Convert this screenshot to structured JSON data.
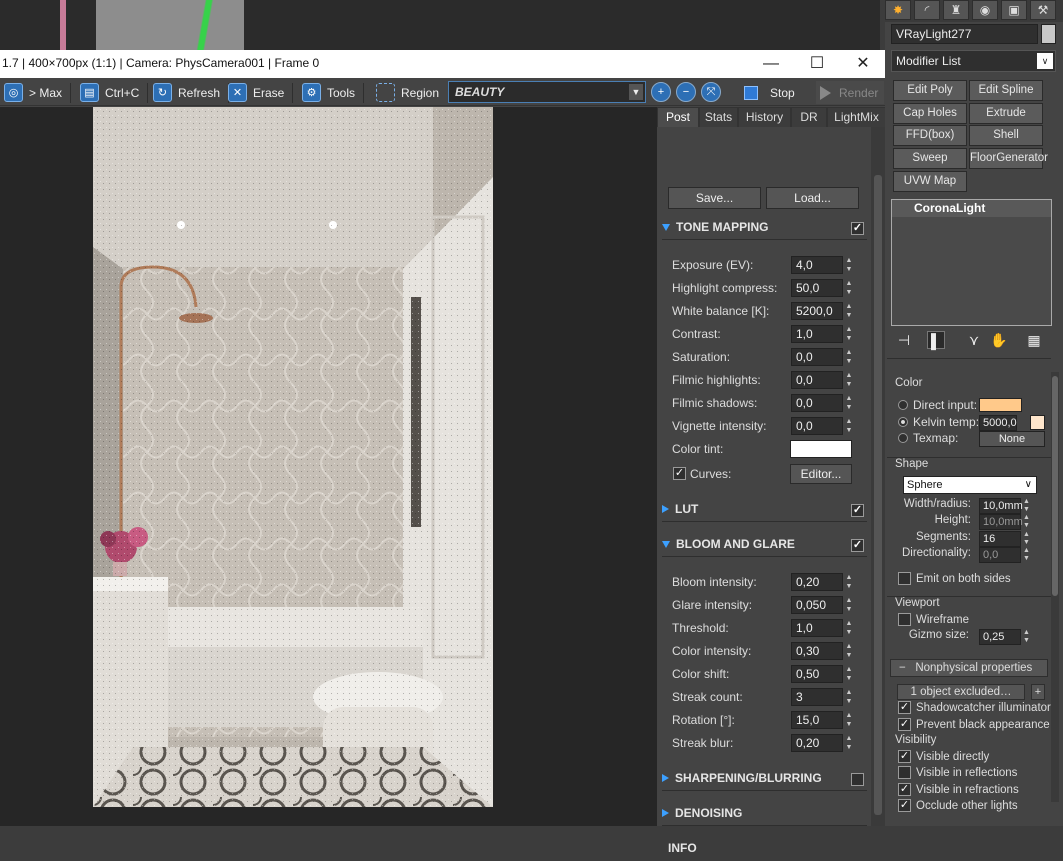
{
  "window": {
    "title": "1.7 | 400×700px (1:1) | Camera: PhysCamera001 | Frame 0",
    "minimize": "—",
    "maximize": "☐",
    "close": "✕"
  },
  "toolbar": {
    "to_max": "> Max",
    "copy": "Ctrl+C",
    "refresh": "Refresh",
    "erase": "Erase",
    "tools": "Tools",
    "region": "Region",
    "channel": "BEAUTY",
    "stop": "Stop",
    "render": "Render"
  },
  "tabs": [
    "Post",
    "Stats",
    "History",
    "DR",
    "LightMix"
  ],
  "post": {
    "save": "Save...",
    "load": "Load...",
    "tone_mapping": {
      "title": "TONE MAPPING",
      "checked": true,
      "rows": [
        {
          "label": "Exposure (EV):",
          "value": "4,0"
        },
        {
          "label": "Highlight compress:",
          "value": "50,0"
        },
        {
          "label": "White balance [K]:",
          "value": "5200,0"
        },
        {
          "label": "Contrast:",
          "value": "1,0"
        },
        {
          "label": "Saturation:",
          "value": "0,0"
        },
        {
          "label": "Filmic highlights:",
          "value": "0,0"
        },
        {
          "label": "Filmic shadows:",
          "value": "0,0"
        },
        {
          "label": "Vignette intensity:",
          "value": "0,0"
        }
      ],
      "color_tint": "Color tint:",
      "curves": "Curves:",
      "editor": "Editor..."
    },
    "lut": {
      "title": "LUT",
      "checked": true
    },
    "bloom": {
      "title": "BLOOM AND GLARE",
      "checked": true,
      "rows": [
        {
          "label": "Bloom intensity:",
          "value": "0,20"
        },
        {
          "label": "Glare intensity:",
          "value": "0,050"
        },
        {
          "label": "Threshold:",
          "value": "1,0"
        },
        {
          "label": "Color intensity:",
          "value": "0,30"
        },
        {
          "label": "Color shift:",
          "value": "0,50"
        },
        {
          "label": "Streak count:",
          "value": "3"
        },
        {
          "label": "Rotation [°]:",
          "value": "15,0"
        },
        {
          "label": "Streak blur:",
          "value": "0,20"
        }
      ]
    },
    "sharpening": {
      "title": "SHARPENING/BLURRING",
      "checked": false
    },
    "denoising": {
      "title": "DENOISING"
    },
    "info": {
      "title": "INFO"
    }
  },
  "cmd": {
    "object_name": "VRayLight277",
    "modifier_list": "Modifier List",
    "buttons": [
      "Edit Poly",
      "Edit Spline",
      "Cap Holes",
      "Extrude",
      "FFD(box)",
      "Shell",
      "Sweep",
      "FloorGenerator",
      "UVW Map"
    ],
    "stack_item": "CoronaLight",
    "color_group": "Color",
    "direct_input": "Direct input:",
    "kelvin_temp": "Kelvin temp:",
    "kelvin_value": "5000,0",
    "texmap": "Texmap:",
    "texmap_value": "None",
    "shape_group": "Shape",
    "shape_value": "Sphere",
    "width_radius": "Width/radius:",
    "width_value": "10,0mm",
    "height": "Height:",
    "height_value": "10,0mm",
    "segments": "Segments:",
    "segments_value": "16",
    "directionality": "Directionality:",
    "directionality_value": "0,0",
    "emit_both": "Emit on both sides",
    "viewport_group": "Viewport",
    "wireframe": "Wireframe",
    "gizmo_size": "Gizmo size:",
    "gizmo_value": "0,25",
    "nonphysical": "Nonphysical properties",
    "excluded": "1 object excluded…",
    "shadowcatcher": "Shadowcatcher illuminator",
    "prevent_black": "Prevent black appearance",
    "visibility_group": "Visibility",
    "visible_directly": "Visible directly",
    "visible_reflections": "Visible in reflections",
    "visible_refractions": "Visible in refractions",
    "occlude": "Occlude other lights"
  },
  "colors": {
    "accent": "#3ca0ff",
    "direct_swatch": "#ffc98a",
    "kelvin_swatch": "#ffe6cc",
    "tint_swatch": "#ffffff"
  }
}
